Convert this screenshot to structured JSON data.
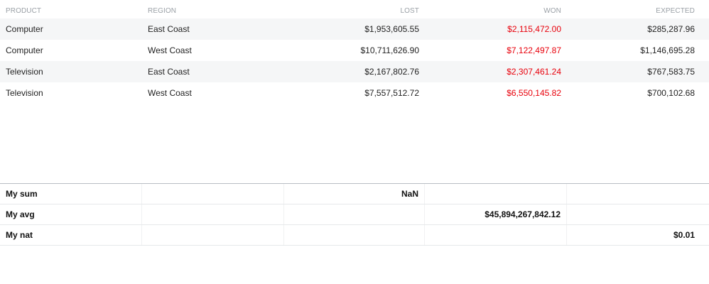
{
  "columns": {
    "product": "PRODUCT",
    "region": "REGION",
    "lost": "LOST",
    "won": "WON",
    "expected": "EXPECTED"
  },
  "rows": [
    {
      "product": "Computer",
      "region": "East Coast",
      "lost": "$1,953,605.55",
      "won": "$2,115,472.00",
      "expected": "$285,287.96"
    },
    {
      "product": "Computer",
      "region": "West Coast",
      "lost": "$10,711,626.90",
      "won": "$7,122,497.87",
      "expected": "$1,146,695.28"
    },
    {
      "product": "Television",
      "region": "East Coast",
      "lost": "$2,167,802.76",
      "won": "$2,307,461.24",
      "expected": "$767,583.75"
    },
    {
      "product": "Television",
      "region": "West Coast",
      "lost": "$7,557,512.72",
      "won": "$6,550,145.82",
      "expected": "$700,102.68"
    }
  ],
  "footer": [
    {
      "label": "My sum",
      "lost": "NaN",
      "won": "",
      "expected": ""
    },
    {
      "label": "My avg",
      "lost": "",
      "won": "$45,894,267,842.12",
      "expected": ""
    },
    {
      "label": "My nat",
      "lost": "",
      "won": "",
      "expected": "$0.01"
    }
  ],
  "colors": {
    "won_text": "#e8000b",
    "alt_row_bg": "#f5f6f7",
    "header_text": "#9aa0a6"
  }
}
